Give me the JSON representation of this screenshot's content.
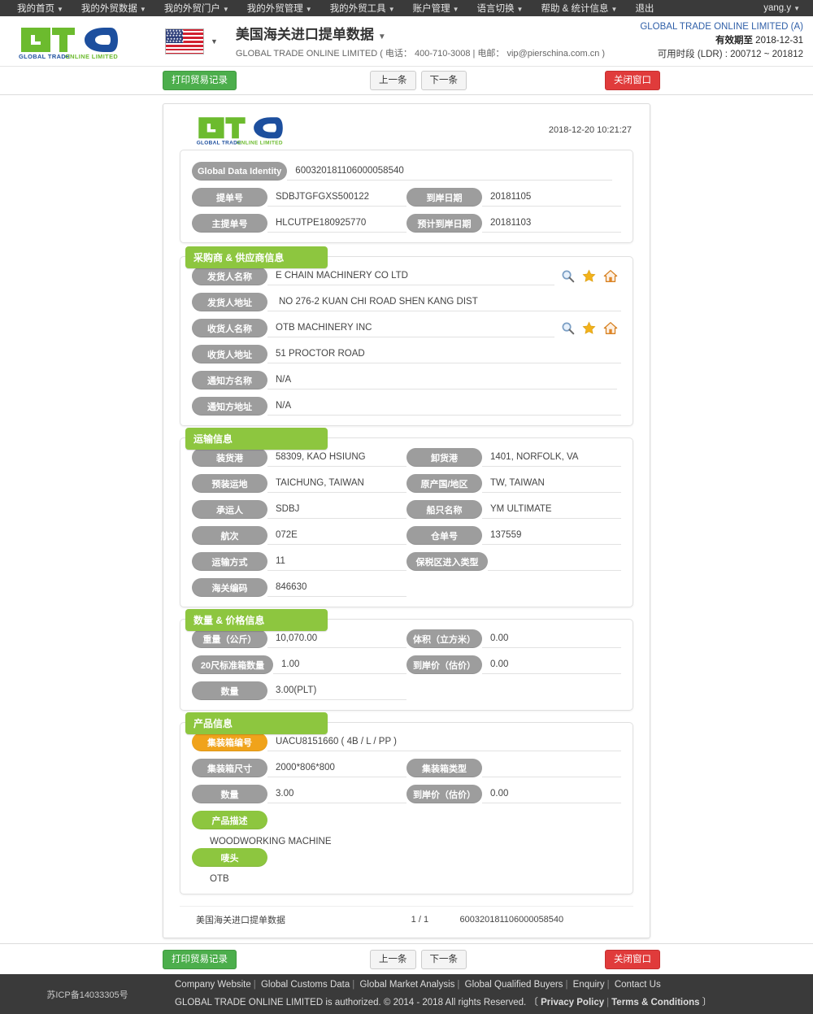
{
  "topnav": {
    "items": [
      {
        "label": "我的首页",
        "caret": true
      },
      {
        "label": "我的外贸数据",
        "caret": true
      },
      {
        "label": "我的外贸门户",
        "caret": true
      },
      {
        "label": "我的外贸管理",
        "caret": true
      },
      {
        "label": "我的外贸工具",
        "caret": true
      },
      {
        "label": "账户管理",
        "caret": true
      },
      {
        "label": "语言切换",
        "caret": true
      },
      {
        "label": "帮助 & 统计信息",
        "caret": true
      },
      {
        "label": "退出",
        "caret": false
      }
    ],
    "user": "yang.y"
  },
  "header": {
    "logo_text": "GLOBAL TRADE ONLINE LIMITED",
    "flag": "us-flag-icon",
    "title": "美国海关进口提单数据",
    "subtitle": "GLOBAL TRADE ONLINE LIMITED ( 电话： 400-710-3008 | 电邮： vip@pierschina.com.cn )",
    "account_name": "GLOBAL TRADE ONLINE LIMITED (A)",
    "valid_label": "有效期至",
    "valid_value": "2018-12-31",
    "ldr_text": "可用时段 (LDR) : 200712 ~ 201812"
  },
  "actions": {
    "print": "打印贸易记录",
    "prev": "上一条",
    "next": "下一条",
    "close": "关闭窗口"
  },
  "sheet": {
    "timestamp": "2018-12-20 10:21:27",
    "identity": {
      "rows": [
        {
          "label": "Global Data Identity",
          "value": "600320181106000058540",
          "wide": true
        },
        {
          "label": "提单号",
          "value": "SDBJTGFGXS500122",
          "label2": "到岸日期",
          "value2": "20181105"
        },
        {
          "label": "主提单号",
          "value": "HLCUTPE180925770",
          "label2": "预计到岸日期",
          "value2": "20181103"
        }
      ]
    },
    "supplier": {
      "title": "采购商 & 供应商信息",
      "rows": [
        {
          "label": "发货人名称",
          "value": "E CHAIN MACHINERY CO LTD",
          "icons": true
        },
        {
          "label": "发货人地址",
          "value": "NO 276-2 KUAN CHI ROAD SHEN KANG DIST",
          "icons": false
        },
        {
          "label": "收货人名称",
          "value": "OTB MACHINERY INC",
          "icons": true
        },
        {
          "label": "收货人地址",
          "value": "51 PROCTOR ROAD",
          "icons": false
        },
        {
          "label": "通知方名称",
          "value": "N/A",
          "icons": false
        },
        {
          "label": "通知方地址",
          "value": "N/A",
          "icons": false
        }
      ]
    },
    "transport": {
      "title": "运输信息",
      "rows": [
        {
          "label": "装货港",
          "value": "58309, KAO HSIUNG",
          "label2": "卸货港",
          "value2": "1401, NORFOLK, VA"
        },
        {
          "label": "预装运地",
          "value": "TAICHUNG, TAIWAN",
          "label2": "原产国/地区",
          "value2": "TW, TAIWAN"
        },
        {
          "label": "承运人",
          "value": "SDBJ",
          "label2": "船只名称",
          "value2": "YM ULTIMATE"
        },
        {
          "label": "航次",
          "value": "072E",
          "label2": "仓单号",
          "value2": "137559"
        },
        {
          "label": "运输方式",
          "value": "11",
          "label2": "保税区进入类型",
          "value2": ""
        },
        {
          "label": "海关编码",
          "value": "846630",
          "label2": "",
          "value2": ""
        }
      ]
    },
    "quantity": {
      "title": "数量 & 价格信息",
      "rows": [
        {
          "label": "重量（公斤）",
          "value": "10,070.00",
          "label2": "体积（立方米）",
          "value2": "0.00"
        },
        {
          "label": "20尺标准箱数量",
          "value": "1.00",
          "label2": "到岸价（估价）",
          "value2": "0.00"
        },
        {
          "label": "数量",
          "value": "3.00(PLT)",
          "label2": "",
          "value2": ""
        }
      ]
    },
    "product": {
      "title": "产品信息",
      "rows": [
        {
          "label": "集装箱编号",
          "value": "UACU8151660 ( 4B / L / PP )",
          "style": "orange",
          "full": true
        },
        {
          "label": "集装箱尺寸",
          "value": "2000*806*800",
          "label2": "集装箱类型",
          "value2": ""
        },
        {
          "label": "数量",
          "value": "3.00",
          "label2": "到岸价（估价）",
          "value2": "0.00"
        }
      ],
      "desc_label": "产品描述",
      "desc_value": "WOODWORKING MACHINE",
      "mark_label": "唛头",
      "mark_value": "OTB"
    },
    "footer": {
      "name": "美国海关进口提单数据",
      "page": "1 / 1",
      "id": "600320181106000058540"
    }
  },
  "footer": {
    "icp": "苏ICP备14033305号",
    "links": [
      "Company Website",
      "Global Customs Data",
      "Global Market Analysis",
      "Global Qualified Buyers",
      "Enquiry",
      "Contact Us"
    ],
    "copyright_pre": "GLOBAL TRADE ONLINE LIMITED is authorized. © 2014 - 2018 All rights Reserved. 〔",
    "privacy": "Privacy Policy",
    "terms": "Terms & Conditions",
    "copyright_post": "〕"
  },
  "colors": {
    "green": "#8dc63f",
    "orange": "#f0a31b",
    "grey_label": "#9d9d9d",
    "dark": "#3a3a3a",
    "red": "#e03b3b",
    "link_blue": "#2f5fa8"
  }
}
